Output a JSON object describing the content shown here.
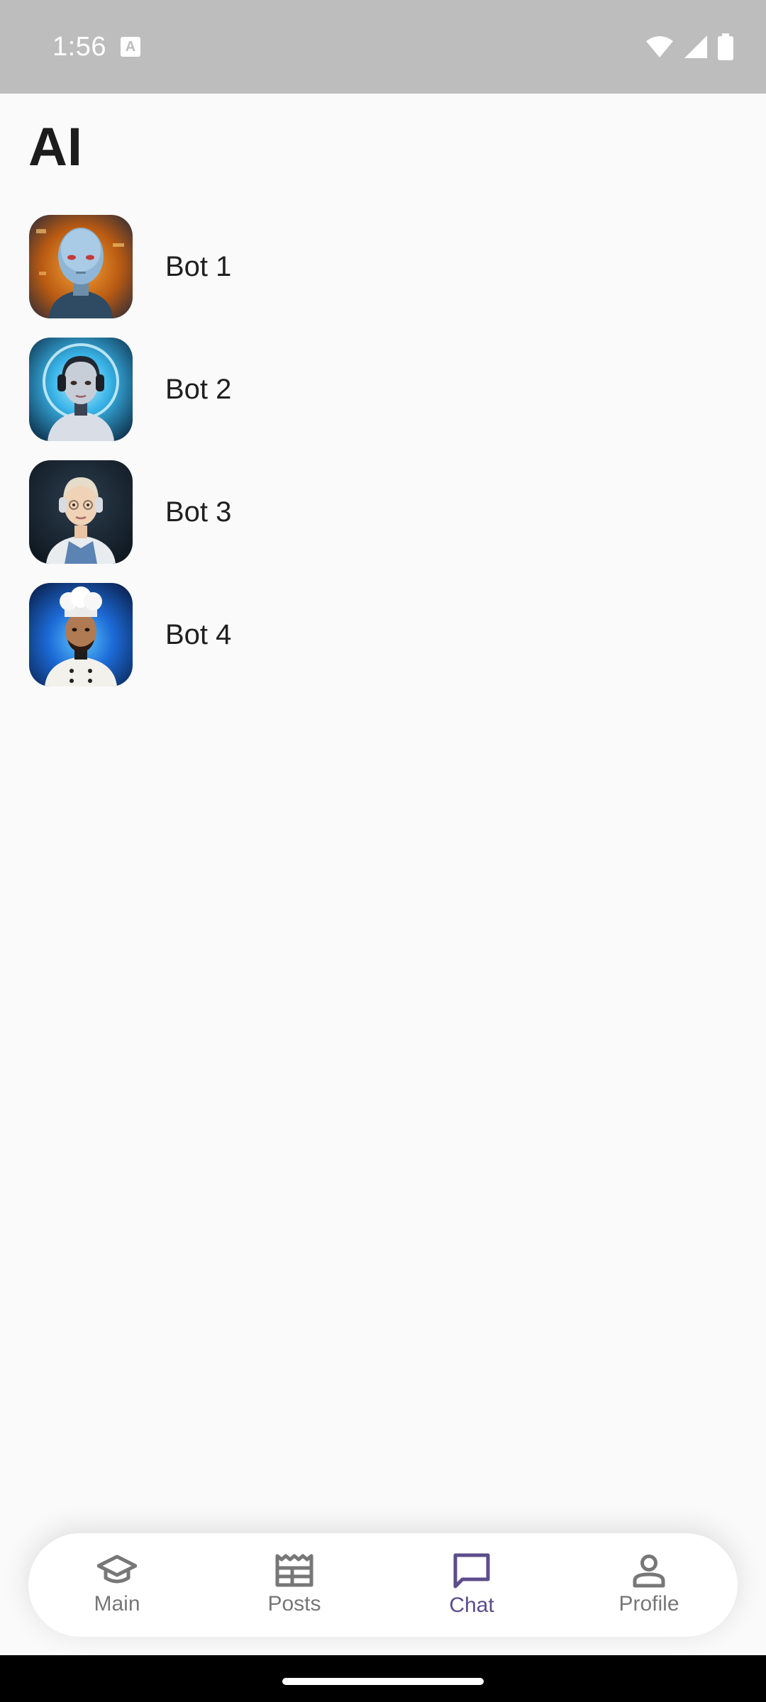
{
  "status_bar": {
    "time": "1:56",
    "notification_icon": "a-text-icon",
    "icons": [
      "wifi-icon",
      "cell-signal-icon",
      "battery-icon"
    ]
  },
  "header": {
    "title": "AI"
  },
  "bots": [
    {
      "name": "Bot 1",
      "avatar": "robot-portrait"
    },
    {
      "name": "Bot 2",
      "avatar": "headset-android-portrait"
    },
    {
      "name": "Bot 3",
      "avatar": "headphones-woman-portrait"
    },
    {
      "name": "Bot 4",
      "avatar": "chef-portrait"
    }
  ],
  "bottom_nav": {
    "items": [
      {
        "label": "Main",
        "icon": "graduation-cap-icon",
        "active": false
      },
      {
        "label": "Posts",
        "icon": "newspaper-icon",
        "active": false
      },
      {
        "label": "Chat",
        "icon": "chat-bubble-icon",
        "active": true
      },
      {
        "label": "Profile",
        "icon": "person-icon",
        "active": false
      }
    ]
  },
  "colors": {
    "status_bar": "#bdbdbd",
    "background": "#fafafa",
    "nav_active": "#5c4d8c",
    "nav_inactive": "#777777"
  }
}
